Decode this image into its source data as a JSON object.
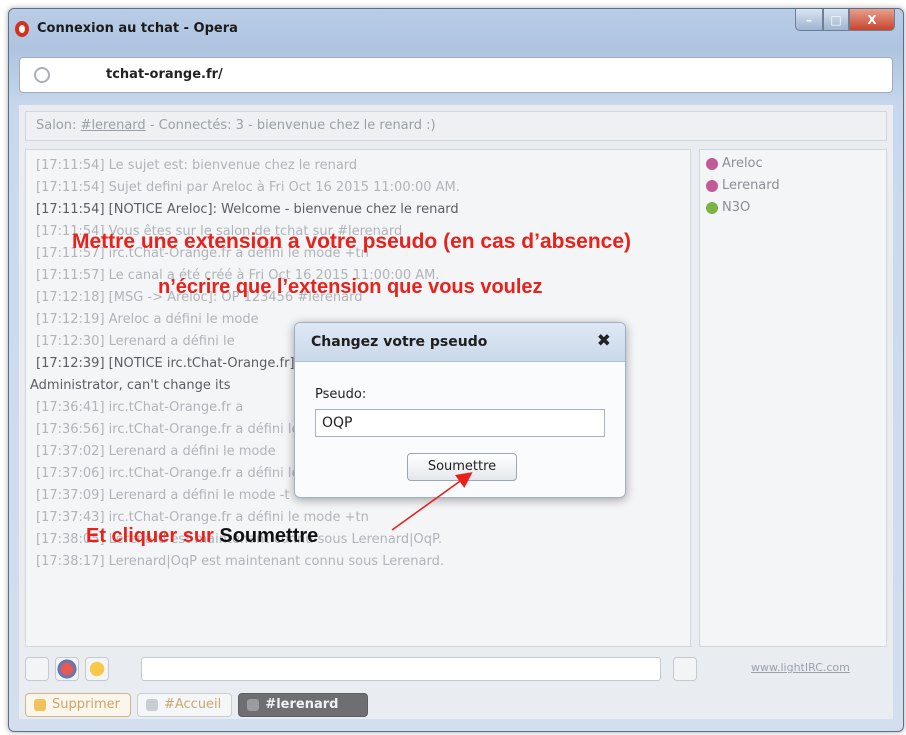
{
  "window": {
    "title": "Connexion au tchat - Opera",
    "minimize_label": "–",
    "maximize_label": "□",
    "close_label": "X"
  },
  "addressbar": {
    "url": "tchat-orange.fr/"
  },
  "salon": {
    "prefix": "Salon: ",
    "channel": "#lerenard",
    "suffix": " - Connectés: 3 - bienvenue chez le renard :)"
  },
  "messages": [
    "[17:11:54] Le sujet est: bienvenue chez le renard",
    "[17:11:54] Sujet defini par Areloc à Fri Oct 16 2015 11:00:00 AM.",
    "[17:11:54] [NOTICE Areloc]: Welcome - bienvenue chez le renard",
    "[17:11:54] Vous êtes sur le salon de tchat sur #lerenard",
    "[17:11:57] irc.tChat-Orange.fr a défini le mode +tn",
    "[17:11:57] Le canal a été créé à Fri Oct 16 2015 11:00:00 AM.",
    "[17:12:18] [MSG -> Areloc]: OP 123456 #lerenard",
    "[17:12:19] Areloc a défini le mode",
    "[17:12:30] Lerenard a défini le",
    "[17:12:39] [NOTICE irc.tChat-Orange.fr]: *** Notice -- N3O is a Services",
    "Administrator, can't change its",
    "[17:36:41] irc.tChat-Orange.fr a",
    "[17:36:56] irc.tChat-Orange.fr a défini le mode",
    "[17:37:02] Lerenard a défini le mode",
    "[17:37:06] irc.tChat-Orange.fr a défini le mode",
    "[17:37:09] Lerenard a défini le mode -t",
    "[17:37:43] irc.tChat-Orange.fr a défini le mode +tn",
    "[17:38:05] Lerenard est maintenant connu sous Lerenard|OqP.",
    "[17:38:17] Lerenard|OqP est maintenant connu sous Lerenard."
  ],
  "users": [
    {
      "name": "Areloc",
      "color": "#c25a98"
    },
    {
      "name": "Lerenard",
      "color": "#c25a98"
    },
    {
      "name": "N3O",
      "color": "#7cb342"
    }
  ],
  "toolbar": {
    "send_icon": "send-icon"
  },
  "credit": "www.lightIRC.com",
  "tabs": [
    {
      "label": "Supprimer"
    },
    {
      "label": "#Accueil"
    },
    {
      "label": "#lerenard"
    }
  ],
  "annotations": {
    "line1": "Mettre une extension a votre pseudo (en cas d’absence)",
    "line2": "n’écrire que l’extension que vous voulez",
    "line3_prefix": "Et cliquer sur ",
    "line3_word": "Soumettre"
  },
  "dialog": {
    "title": "Changez votre pseudo",
    "close": "✖",
    "label": "Pseudo:",
    "value": "OQP",
    "submit": "Soumettre"
  }
}
